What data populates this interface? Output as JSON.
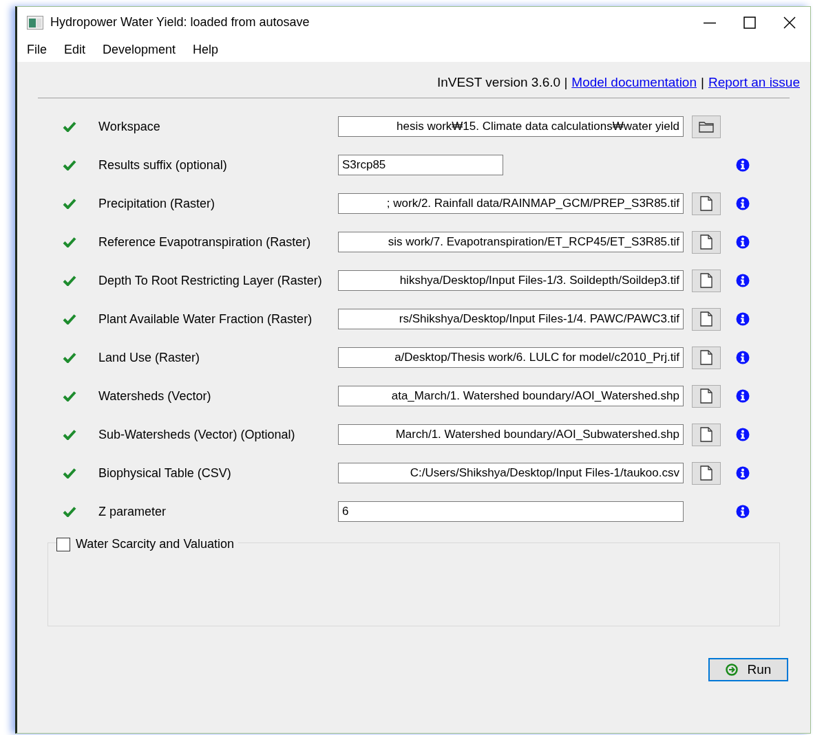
{
  "window": {
    "title": "Hydropower Water Yield: loaded from autosave"
  },
  "menu": [
    "File",
    "Edit",
    "Development",
    "Help"
  ],
  "header": {
    "version": "InVEST version 3.6.0 |",
    "links": [
      "Model documentation",
      "Report an issue"
    ],
    "separator": "|"
  },
  "inputs": [
    {
      "label": "Workspace",
      "valid": true,
      "kind": "folder",
      "value": "hesis work₩15. Climate data calculations₩water yield",
      "info": false
    },
    {
      "label": "Results suffix (optional)",
      "valid": true,
      "kind": "short_text",
      "value": "S3rcp85",
      "info": true
    },
    {
      "label": "Precipitation (Raster)",
      "valid": true,
      "kind": "file",
      "value": "; work/2. Rainfall data/RAINMAP_GCM/PREP_S3R85.tif",
      "info": true
    },
    {
      "label": "Reference Evapotranspiration (Raster)",
      "valid": true,
      "kind": "file",
      "value": "sis work/7. Evapotranspiration/ET_RCP45/ET_S3R85.tif",
      "info": true
    },
    {
      "label": "Depth To Root Restricting Layer (Raster)",
      "valid": true,
      "kind": "file",
      "value": "hikshya/Desktop/Input Files-1/3. Soildepth/Soildep3.tif",
      "info": true
    },
    {
      "label": "Plant Available Water Fraction (Raster)",
      "valid": true,
      "kind": "file",
      "value": "rs/Shikshya/Desktop/Input Files-1/4. PAWC/PAWC3.tif",
      "info": true
    },
    {
      "label": "Land Use (Raster)",
      "valid": true,
      "kind": "file",
      "value": "a/Desktop/Thesis work/6. LULC for model/c2010_Prj.tif",
      "info": true
    },
    {
      "label": "Watersheds (Vector)",
      "valid": true,
      "kind": "file",
      "value": "ata_March/1. Watershed boundary/AOI_Watershed.shp",
      "info": true
    },
    {
      "label": "Sub-Watersheds (Vector) (Optional)",
      "valid": true,
      "kind": "file",
      "value": "March/1. Watershed boundary/AOI_Subwatershed.shp",
      "info": true
    },
    {
      "label": "Biophysical Table (CSV)",
      "valid": true,
      "kind": "file",
      "value": "C:/Users/Shikshya/Desktop/Input Files-1/taukoo.csv",
      "info": true
    },
    {
      "label": "Z parameter",
      "valid": true,
      "kind": "text",
      "value": "6",
      "info": true
    }
  ],
  "group": {
    "label": "Water Scarcity and Valuation",
    "checked": false
  },
  "run_button": "Run"
}
